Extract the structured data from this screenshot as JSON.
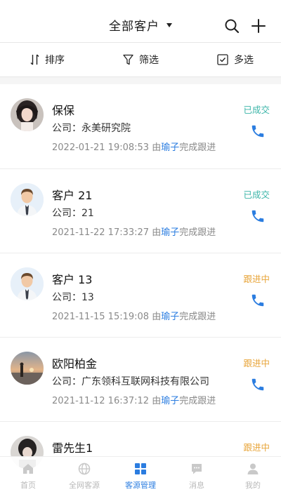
{
  "header": {
    "title": "全部客户"
  },
  "toolbar": {
    "sort_label": "排序",
    "filter_label": "筛选",
    "multi_label": "多选"
  },
  "customers": [
    {
      "name": "保保",
      "company": "公司：永美研究院",
      "time": "2022-01-21 19:08:53",
      "by": "由",
      "who": "瑜子",
      "action": "完成跟进",
      "status": "已成交"
    },
    {
      "name": "客户 21",
      "company": "公司：21",
      "time": "2021-11-22 17:33:27",
      "by": "由",
      "who": "瑜子",
      "action": "完成跟进",
      "status": "已成交"
    },
    {
      "name": "客户 13",
      "company": "公司：13",
      "time": "2021-11-15 15:19:08",
      "by": "由",
      "who": "瑜子",
      "action": "完成跟进",
      "status": "跟进中"
    },
    {
      "name": "欧阳柏金",
      "company": "公司：广东领科互联网科技有限公司",
      "time": "2021-11-12 16:37:12",
      "by": "由",
      "who": "瑜子",
      "action": "完成跟进",
      "status": "跟进中"
    },
    {
      "name": "雷先生1",
      "company": "",
      "time": "",
      "by": "",
      "who": "",
      "action": "",
      "status": "跟进中"
    }
  ],
  "tabs": [
    {
      "label": "首页"
    },
    {
      "label": "全网客源"
    },
    {
      "label": "客源管理"
    },
    {
      "label": "消息"
    },
    {
      "label": "我的"
    }
  ],
  "colors": {
    "accent": "#2b7de0",
    "done": "#3bb5a8",
    "follow": "#e8a53a"
  }
}
